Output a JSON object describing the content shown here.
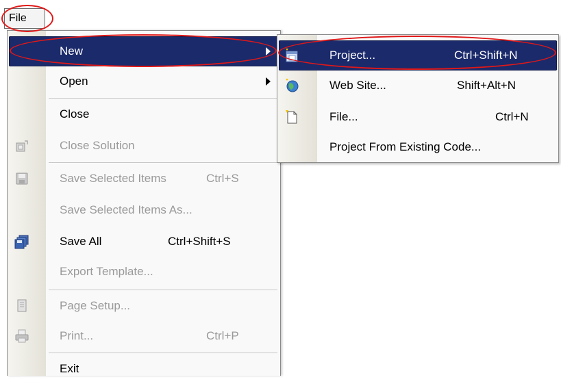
{
  "menubar": {
    "file_label": "File"
  },
  "file_menu": {
    "new": {
      "label": "New"
    },
    "open": {
      "label": "Open"
    },
    "close": {
      "label": "Close"
    },
    "close_solution": {
      "label": "Close Solution"
    },
    "save_selected": {
      "label": "Save Selected Items",
      "shortcut": "Ctrl+S"
    },
    "save_selected_as": {
      "label": "Save Selected Items As..."
    },
    "save_all": {
      "label": "Save All",
      "shortcut": "Ctrl+Shift+S"
    },
    "export_template": {
      "label": "Export Template..."
    },
    "page_setup": {
      "label": "Page Setup..."
    },
    "print": {
      "label": "Print...",
      "shortcut": "Ctrl+P"
    },
    "exit": {
      "label": "Exit"
    }
  },
  "new_submenu": {
    "project": {
      "label": "Project...",
      "shortcut": "Ctrl+Shift+N"
    },
    "web_site": {
      "label": "Web Site...",
      "shortcut": "Shift+Alt+N"
    },
    "file": {
      "label": "File...",
      "shortcut": "Ctrl+N"
    },
    "from_existing": {
      "label": "Project From Existing Code..."
    }
  },
  "colors": {
    "highlight": "#1b2a6b",
    "annotation_ring": "#e01818",
    "disabled_text": "#9a9a9a"
  }
}
